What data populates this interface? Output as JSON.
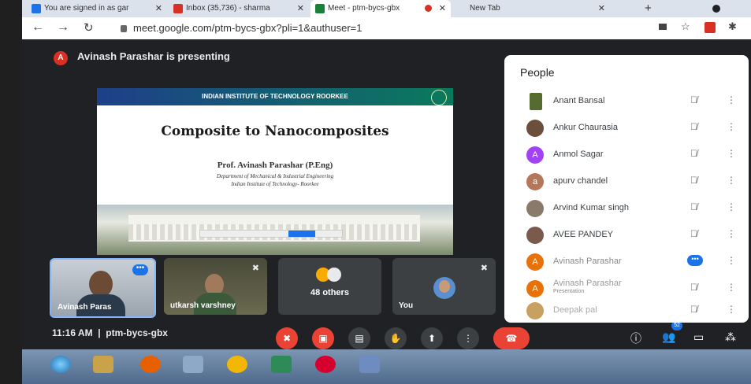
{
  "browser": {
    "tabs": [
      {
        "label": "You are signed in as gar",
        "color": "#1a73e8"
      },
      {
        "label": "Inbox (35,736) - sharma",
        "color": "#d93025"
      },
      {
        "label": "Meet - ptm-bycs-gbx",
        "color": "#188038"
      },
      {
        "label": "New Tab",
        "color": ""
      }
    ],
    "new_tab_icon": "+",
    "url": "meet.google.com/ptm-bycs-gbx?pli=1&authuser=1"
  },
  "meet": {
    "presenter_avatar": "A",
    "presenter_text": "Avinash Parashar is presenting",
    "slide": {
      "header": "INDIAN INSTITUTE OF TECHNOLOGY ROORKEE",
      "title": "Composite to Nanocomposites",
      "author": "Prof. Avinash Parashar (P.Eng)",
      "dept": "Department of Mechanical & Industrial Engineering",
      "inst": "Indian Institute of Technology- Roorkee"
    },
    "tiles": [
      {
        "name": "Avinash Paras",
        "status": "more-options"
      },
      {
        "name": "utkarsh varshney",
        "status": "muted"
      },
      {
        "name": "48 others",
        "status": ""
      },
      {
        "name": "You",
        "status": "muted"
      }
    ],
    "bottom": {
      "time": "11:16 AM",
      "separator": "|",
      "meeting_code": "ptm-bycs-gbx",
      "people_count": "52"
    }
  },
  "people_panel": {
    "title": "People",
    "participants": [
      {
        "name": "Anant Bansal",
        "avatar": "",
        "avatar_color": "#556b2f",
        "status": "muted"
      },
      {
        "name": "Ankur Chaurasia",
        "avatar": "",
        "avatar_color": "#6b4f3a",
        "status": "muted"
      },
      {
        "name": "Anmol Sagar",
        "avatar": "A",
        "avatar_color": "#a142f4",
        "status": "muted"
      },
      {
        "name": "apurv chandel",
        "avatar": "a",
        "avatar_color": "#b4775a",
        "status": "muted"
      },
      {
        "name": "Arvind Kumar singh",
        "avatar": "",
        "avatar_color": "#8a7a6a",
        "status": "muted"
      },
      {
        "name": "AVEE PANDEY",
        "avatar": "",
        "avatar_color": "#7a5a4a",
        "status": "muted"
      },
      {
        "name": "Avinash Parashar",
        "avatar": "A",
        "avatar_color": "#e8710a",
        "status": "speaking"
      },
      {
        "name": "Avinash Parashar",
        "sub": "Presentation",
        "avatar": "A",
        "avatar_color": "#e8710a",
        "status": "muted"
      },
      {
        "name": "Deepak pal",
        "avatar": "",
        "avatar_color": "#c8a060",
        "status": "muted"
      }
    ]
  }
}
